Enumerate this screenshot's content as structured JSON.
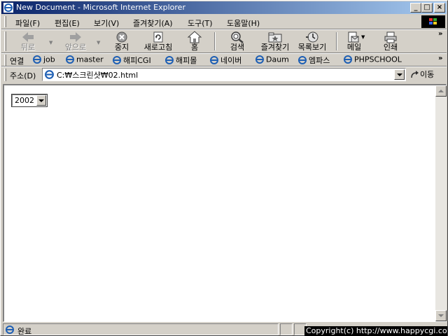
{
  "window": {
    "title": "New Document - Microsoft Internet Explorer",
    "controls": {
      "minimize": "_",
      "maximize": "□",
      "close": "×"
    }
  },
  "menubar": {
    "items": [
      "파일(F)",
      "편집(E)",
      "보기(V)",
      "즐겨찾기(A)",
      "도구(T)",
      "도움말(H)"
    ]
  },
  "toolbar": {
    "back": "뒤로",
    "forward": "앞으로",
    "stop": "중지",
    "refresh": "새로고침",
    "home": "홈",
    "search": "검색",
    "favorites": "즐겨찾기",
    "history": "목록보기",
    "mail": "메일",
    "print": "인쇄",
    "more": "»"
  },
  "links": {
    "label": "연결",
    "items": [
      "job",
      "master",
      "해피CGI",
      "해피몰",
      "네이버",
      "Daum",
      "엠파스",
      "PHPSCHOOL"
    ],
    "more": "»"
  },
  "address": {
    "label": "주소(D)",
    "value": "C:₩스크린샷₩02.html",
    "go": "이동"
  },
  "page": {
    "year_select": {
      "selected": "2002"
    }
  },
  "status": {
    "text": "완료",
    "copyright": "Copyright(c) http://www.happycgi.com"
  },
  "colors": {
    "title_start": "#0a246a",
    "title_end": "#a6caf0",
    "chrome": "#d4d0c8"
  },
  "icons": {
    "app": "ie-logo-icon",
    "back": "back-arrow-icon",
    "forward": "forward-arrow-icon",
    "stop": "stop-icon",
    "refresh": "refresh-icon",
    "home": "home-icon",
    "search": "search-icon",
    "favorites": "favorites-folder-icon",
    "history": "history-icon",
    "mail": "mail-icon",
    "print": "printer-icon"
  }
}
